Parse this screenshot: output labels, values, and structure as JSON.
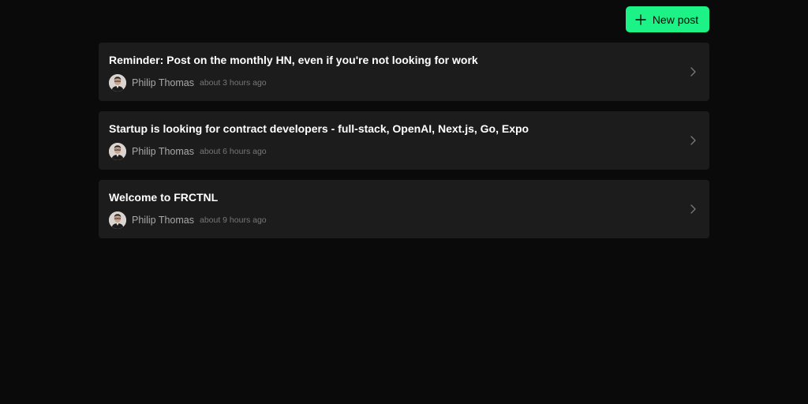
{
  "header": {
    "new_post_label": "New post",
    "accent_color": "#1cf285"
  },
  "icons": {
    "new_post": "plus-icon",
    "row_action": "chevron-right-icon"
  },
  "posts": [
    {
      "title": "Reminder: Post on the monthly HN, even if you're not looking for work",
      "author": "Philip Thomas",
      "time": "about 3 hours ago"
    },
    {
      "title": "Startup is looking for contract developers - full-stack, OpenAI, Next.js, Go, Expo",
      "author": "Philip Thomas",
      "time": "about 6 hours ago"
    },
    {
      "title": "Welcome to FRCTNL",
      "author": "Philip Thomas",
      "time": "about 9 hours ago"
    }
  ]
}
